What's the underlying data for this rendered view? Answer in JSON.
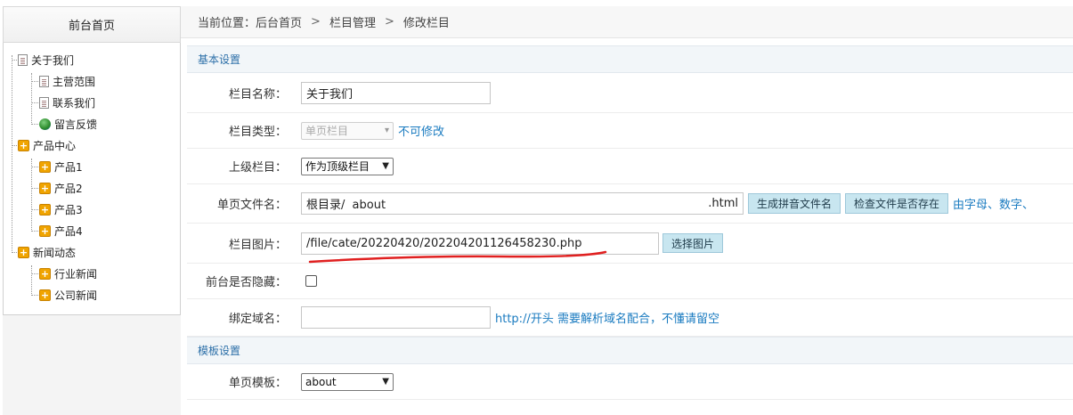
{
  "sidebar": {
    "title": "前台首页",
    "tree": [
      {
        "label": "关于我们",
        "icon": "doc-icon"
      },
      {
        "label": "主营范围",
        "icon": "doc-icon"
      },
      {
        "label": "联系我们",
        "icon": "doc-icon"
      },
      {
        "label": "留言反馈",
        "icon": "globe-icon"
      },
      {
        "label": "产品中心",
        "icon": "plus-folder-icon"
      },
      {
        "label": "产品1",
        "icon": "plus-folder-icon"
      },
      {
        "label": "产品2",
        "icon": "plus-folder-icon"
      },
      {
        "label": "产品3",
        "icon": "plus-folder-icon"
      },
      {
        "label": "产品4",
        "icon": "plus-folder-icon"
      },
      {
        "label": "新闻动态",
        "icon": "plus-folder-icon"
      },
      {
        "label": "行业新闻",
        "icon": "plus-folder-icon"
      },
      {
        "label": "公司新闻",
        "icon": "plus-folder-icon"
      }
    ]
  },
  "breadcrumb": {
    "prefix": "当前位置：",
    "items": [
      "后台首页",
      "栏目管理",
      "修改栏目"
    ],
    "separator": ">"
  },
  "basic": {
    "section_title": "基本设置",
    "name_label": "栏目名称：",
    "name_value": "关于我们",
    "type_label": "栏目类型：",
    "type_value": "单页栏目",
    "type_hint": "不可修改",
    "parent_label": "上级栏目：",
    "parent_value": "作为顶级栏目",
    "file_label": "单页文件名：",
    "file_prefix": "根目录/",
    "file_value": "about",
    "file_suffix": ".html",
    "pinyin_button": "生成拼音文件名",
    "check_button": "检查文件是否存在",
    "file_hint": "由字母、数字、",
    "image_label": "栏目图片：",
    "image_value": "/file/cate/20220420/202204201126458230.php",
    "image_button": "选择图片",
    "hidden_label": "前台是否隐藏：",
    "hidden_checked": false,
    "domain_label": "绑定域名：",
    "domain_value": "",
    "domain_hint": "http://开头 需要解析域名配合，不懂请留空"
  },
  "template": {
    "section_title": "模板设置",
    "page_tpl_label": "单页模板：",
    "page_tpl_value": "about"
  },
  "colors": {
    "link": "#1a7bc0",
    "section_text": "#2c6fa8",
    "button_bg": "#c8e6f0",
    "annotation_red": "#e02020"
  }
}
